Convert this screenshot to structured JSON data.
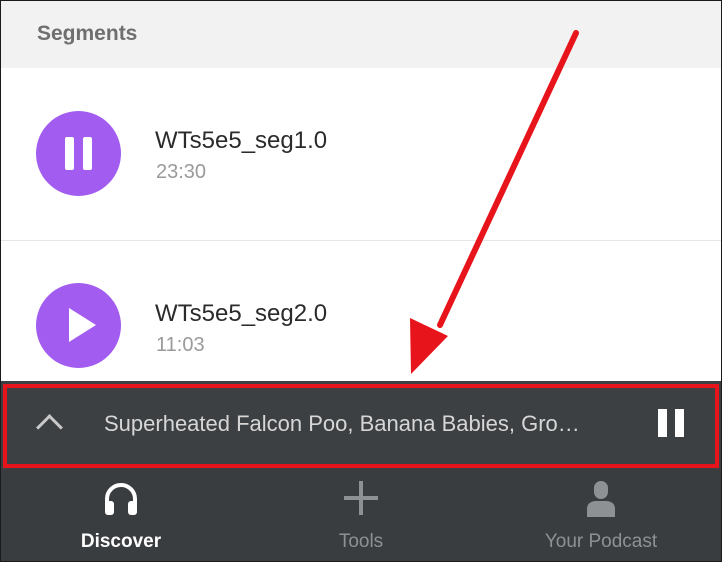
{
  "section": {
    "title": "Segments"
  },
  "segments": [
    {
      "title": "WTs5e5_seg1.0",
      "duration": "23:30",
      "state": "playing"
    },
    {
      "title": "WTs5e5_seg2.0",
      "duration": "11:03",
      "state": "paused"
    }
  ],
  "mini_player": {
    "now_playing": "Superheated Falcon Poo, Banana Babies, Gro…",
    "expand_icon": "chevron-up-icon",
    "control_icon": "pause-icon"
  },
  "tabs": [
    {
      "label": "Discover",
      "icon": "headphones-icon",
      "active": true
    },
    {
      "label": "Tools",
      "icon": "plus-icon",
      "active": false
    },
    {
      "label": "Your Podcast",
      "icon": "person-icon",
      "active": false
    }
  ],
  "colors": {
    "accent": "#a25cf0",
    "annotation": "#e8141c",
    "player_bg": "#3d4043",
    "tabbar_bg": "#3a3d40"
  }
}
